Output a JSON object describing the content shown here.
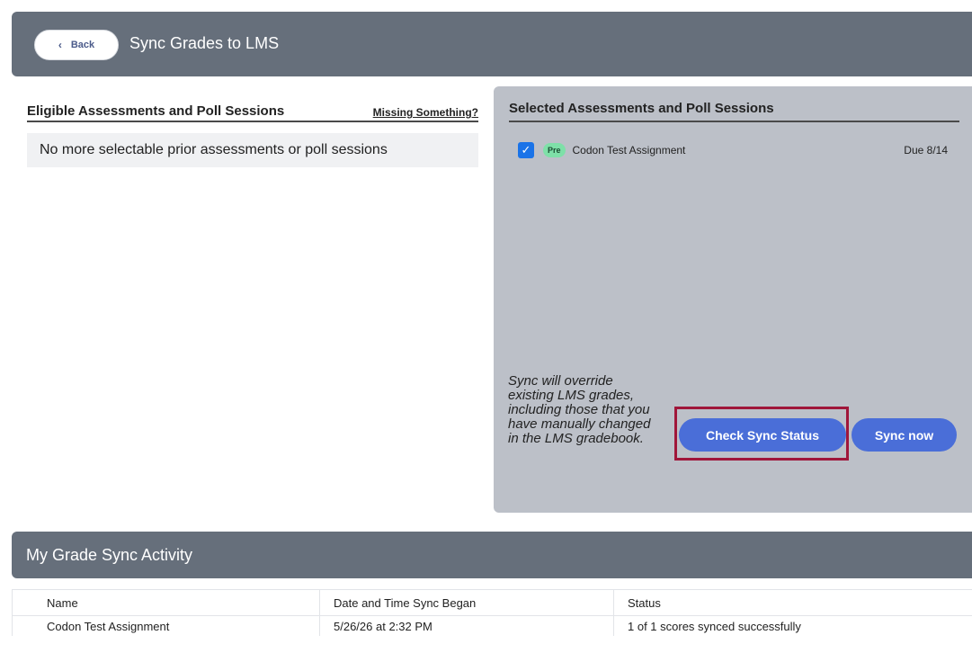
{
  "header": {
    "back_label": "Back",
    "title": "Sync Grades to LMS"
  },
  "eligible": {
    "title": "Eligible Assessments and Poll Sessions",
    "missing_link": "Missing Something?",
    "empty_message": "No more selectable prior assessments or poll sessions"
  },
  "selected": {
    "title": "Selected Assessments and Poll Sessions",
    "items": [
      {
        "checked": true,
        "badge": "Pre",
        "name": "Codon Test Assignment",
        "due": "Due 8/14"
      }
    ],
    "warning": "Sync will override existing LMS grades, including those that you have manually changed in the LMS gradebook.",
    "check_status_label": "Check Sync Status",
    "sync_now_label": "Sync now"
  },
  "activity": {
    "title": "My Grade Sync Activity",
    "columns": [
      "Name",
      "Date and Time Sync Began",
      "Status"
    ],
    "rows": [
      {
        "name": "Codon Test Assignment",
        "date": "5/26/26 at 2:32 PM",
        "status": "1 of 1 scores synced successfully"
      }
    ]
  },
  "colors": {
    "header_bg": "#666f7b",
    "panel_bg": "#bcc0c8",
    "button_blue": "#4a6ed8",
    "highlight": "#a0163a",
    "badge_green": "#7ee0a8",
    "checkbox_blue": "#1a73e8"
  },
  "icons": {
    "back": "chevron-left-icon",
    "checkbox": "check-icon"
  }
}
